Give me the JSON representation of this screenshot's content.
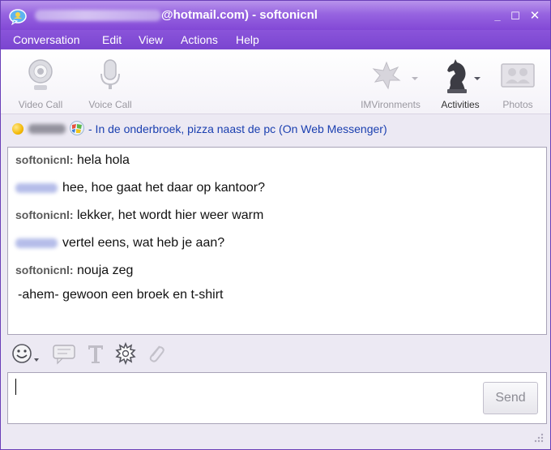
{
  "window": {
    "title": "@hotmail.com) - softonicnl",
    "controls": {
      "minimize": "_",
      "maximize": "☐",
      "close": "✕"
    }
  },
  "menu": [
    "Conversation",
    "Edit",
    "View",
    "Actions",
    "Help"
  ],
  "toolbar": {
    "video_call": "Video Call",
    "voice_call": "Voice Call",
    "imvironments": "IMVironments",
    "activities": "Activities",
    "photos": "Photos"
  },
  "status": {
    "presence_color": "#f2b600",
    "message": "- In de onderbroek, pizza naast de pc (On Web Messenger)"
  },
  "conversation": [
    {
      "speaker": "softonicnl:",
      "blurred": false,
      "text": "hela hola"
    },
    {
      "speaker": "",
      "blurred": true,
      "text": "hee, hoe gaat het daar op kantoor?"
    },
    {
      "speaker": "softonicnl:",
      "blurred": false,
      "text": "lekker, het wordt hier weer warm"
    },
    {
      "speaker": "",
      "blurred": true,
      "text": "vertel eens, wat heb je aan?"
    },
    {
      "speaker": "softonicnl:",
      "blurred": false,
      "text": "nouja zeg"
    },
    {
      "speaker": "",
      "blurred": false,
      "text": " -ahem- gewoon een broek en t-shirt"
    }
  ],
  "format_tools": [
    "emoticon-icon",
    "nudge-icon",
    "font-icon",
    "settings-icon",
    "attach-icon"
  ],
  "input": {
    "value": "",
    "send_label": "Send"
  },
  "colors": {
    "accent": "#8248d6",
    "link": "#1a3fb0"
  }
}
